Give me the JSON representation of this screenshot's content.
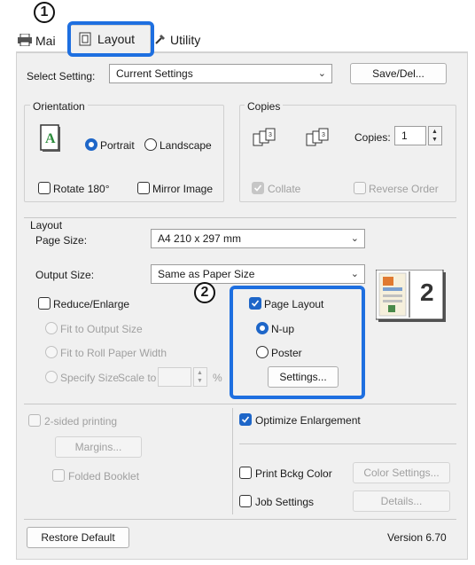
{
  "callouts": {
    "one": "1",
    "two": "2"
  },
  "tabs": {
    "main": "Mai",
    "layout": "Layout",
    "utility": "Utility"
  },
  "select_setting": {
    "label": "Select Setting:",
    "value": "Current Settings",
    "save_button": "Save/Del..."
  },
  "orientation": {
    "title": "Orientation",
    "portrait": "Portrait",
    "landscape": "Landscape",
    "selected": "Portrait",
    "rotate": "Rotate 180°",
    "mirror": "Mirror Image"
  },
  "copies": {
    "title": "Copies",
    "label": "Copies:",
    "value": "1",
    "collate": "Collate",
    "reverse": "Reverse Order"
  },
  "layout": {
    "title": "Layout",
    "page_size_label": "Page Size:",
    "page_size_value": "A4 210 x 297 mm",
    "output_size_label": "Output Size:",
    "output_size_value": "Same as Paper Size",
    "reduce_enlarge": "Reduce/Enlarge",
    "fit_output": "Fit to Output Size",
    "fit_roll": "Fit to Roll Paper Width",
    "specify_size": "Specify Size",
    "scale_to": "Scale to",
    "percent": "%",
    "page_layout": "Page Layout",
    "nup": "N-up",
    "poster": "Poster",
    "settings_button": "Settings...",
    "preview_number": "2"
  },
  "two_sided": {
    "label": "2-sided printing",
    "margins_button": "Margins...",
    "folded_booklet": "Folded Booklet"
  },
  "options": {
    "optimize": "Optimize Enlargement",
    "print_bckg": "Print Bckg Color",
    "color_settings": "Color Settings...",
    "job_settings": "Job Settings",
    "details": "Details..."
  },
  "footer": {
    "restore": "Restore Default",
    "version": "Version 6.70"
  },
  "colors": {
    "highlight": "#1e6fe0",
    "accent": "#1e66c8"
  }
}
